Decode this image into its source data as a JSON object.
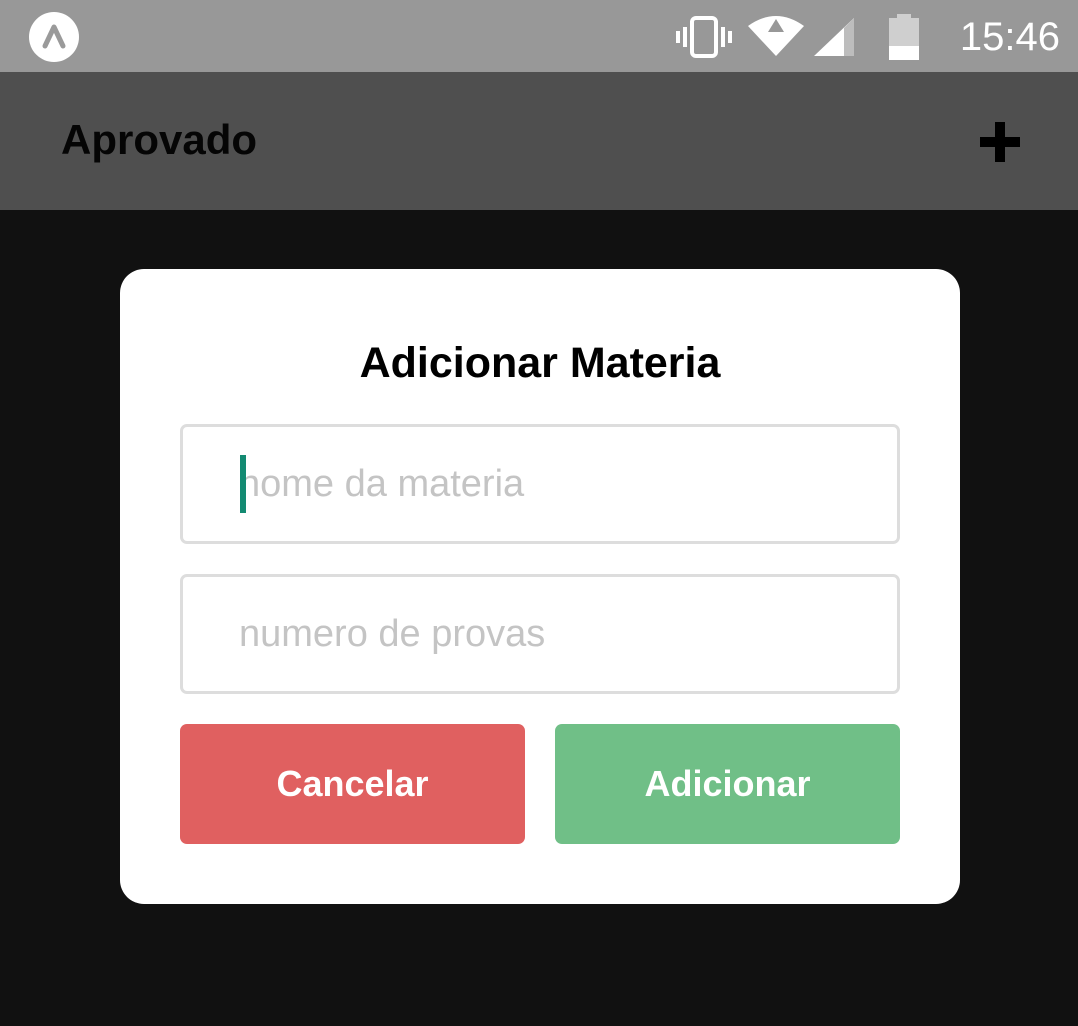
{
  "status_bar": {
    "time": "15:46",
    "icons": [
      "expo-icon",
      "vibrate-icon",
      "wifi-icon",
      "signal-icon",
      "battery-icon"
    ]
  },
  "app_bar": {
    "title": "Aprovado",
    "action_icon": "plus-icon"
  },
  "dialog": {
    "title": "Adicionar Materia",
    "subject_name": {
      "value": "",
      "placeholder": "nome da materia"
    },
    "exam_count": {
      "value": "",
      "placeholder": "numero de provas"
    },
    "cancel_label": "Cancelar",
    "add_label": "Adicionar"
  },
  "colors": {
    "status_bar": "#989898",
    "app_bar": "#4f4f4f",
    "backdrop": "#111111",
    "cancel": "#e06060",
    "add": "#70bf87",
    "cursor": "#138a72"
  }
}
